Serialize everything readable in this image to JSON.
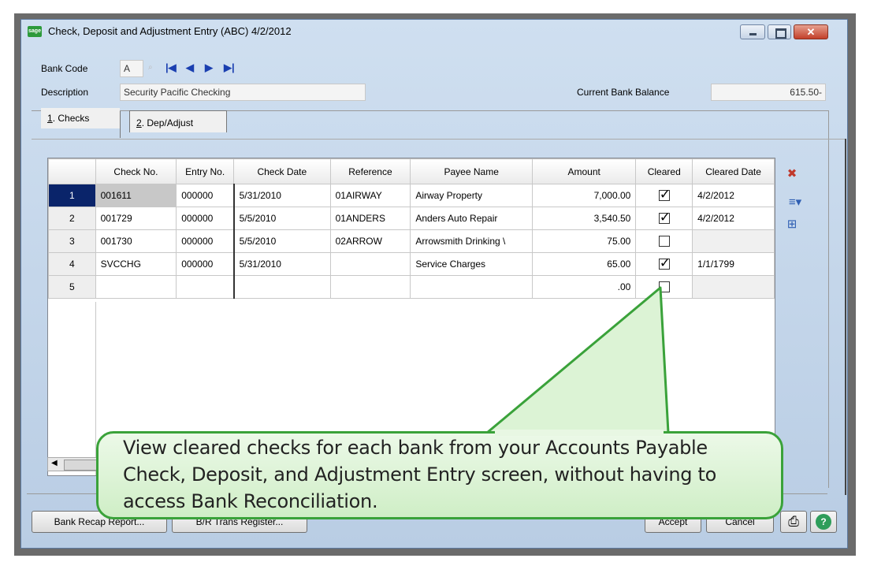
{
  "window": {
    "app_icon_label": "sage",
    "title": "Check, Deposit and Adjustment Entry (ABC) 4/2/2012",
    "close_glyph": "✕"
  },
  "header": {
    "bank_code_label": "Bank Code",
    "bank_code_value": "A",
    "description_label": "Description",
    "description_value": "Security Pacific Checking",
    "current_balance_label": "Current Bank Balance",
    "current_balance_value": "615.50-"
  },
  "nav_icons": [
    "first-record-icon",
    "previous-record-icon",
    "next-record-icon",
    "last-record-icon"
  ],
  "tabs": [
    {
      "prefix": "1",
      "label": ". Checks"
    },
    {
      "prefix": "2",
      "label": ". Dep/Adjust"
    }
  ],
  "grid": {
    "columns": [
      "Check No.",
      "Entry No.",
      "Check Date",
      "Reference",
      "Payee Name",
      "Amount",
      "Cleared",
      "Cleared Date"
    ],
    "rows": [
      {
        "num": "1",
        "check_no": "001611",
        "entry_no": "000000",
        "check_date": "5/31/2010",
        "reference": "01AIRWAY",
        "payee": "Airway Property",
        "amount": "7,000.00",
        "cleared": true,
        "cleared_date": "4/2/2012"
      },
      {
        "num": "2",
        "check_no": "001729",
        "entry_no": "000000",
        "check_date": "5/5/2010",
        "reference": "01ANDERS",
        "payee": "Anders Auto Repair",
        "amount": "3,540.50",
        "cleared": true,
        "cleared_date": "4/2/2012"
      },
      {
        "num": "3",
        "check_no": "001730",
        "entry_no": "000000",
        "check_date": "5/5/2010",
        "reference": "02ARROW",
        "payee": "Arrowsmith Drinking \\",
        "amount": "75.00",
        "cleared": false,
        "cleared_date": ""
      },
      {
        "num": "4",
        "check_no": "SVCCHG",
        "entry_no": "000000",
        "check_date": "5/31/2010",
        "reference": "",
        "payee": "Service Charges",
        "amount": "65.00",
        "cleared": true,
        "cleared_date": "1/1/1799"
      },
      {
        "num": "5",
        "check_no": "",
        "entry_no": "",
        "check_date": "",
        "reference": "",
        "payee": "",
        "amount": ".00",
        "cleared": false,
        "cleared_date": ""
      }
    ]
  },
  "side_icons": [
    "delete-line-icon",
    "insert-line-icon",
    "lookup-icon"
  ],
  "callout": {
    "text": "View cleared checks for each bank from your Accounts Payable Check, Deposit, and Adjustment Entry screen, without having to access Bank Reconciliation."
  },
  "buttons": {
    "bank_recap": "Bank Recap Report...",
    "br_trans": "B/R Trans Register...",
    "accept": "Accept",
    "cancel": "Cancel"
  },
  "colors": {
    "selected_row": "#0a246a",
    "callout_border": "#3aa23a",
    "callout_fill": "#dff5d8",
    "nav_icon": "#1a3fb0"
  }
}
